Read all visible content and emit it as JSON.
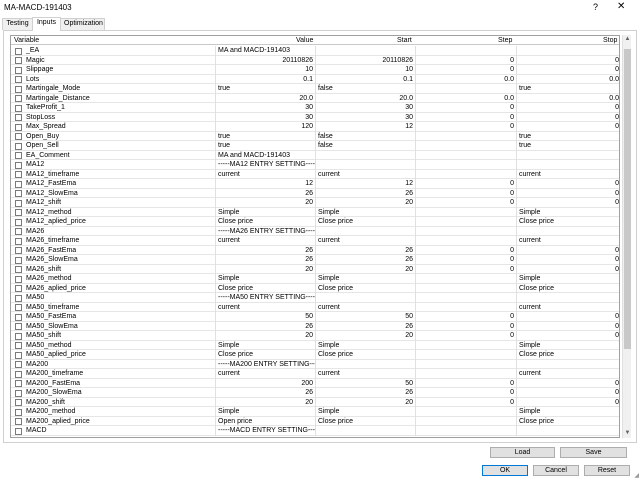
{
  "window": {
    "title": "MA-MACD-191403"
  },
  "tabs": [
    {
      "label": "Testing"
    },
    {
      "label": "Inputs"
    },
    {
      "label": "Optimization"
    }
  ],
  "columns": {
    "variable": "Variable",
    "value": "Value",
    "start": "Start",
    "step": "Step",
    "stop": "Stop"
  },
  "rows": [
    {
      "name": "_EA",
      "value": "MA and MACD-191403",
      "start": "",
      "step": "",
      "stop": ""
    },
    {
      "name": "Magic",
      "value": "20110826",
      "start": "20110826",
      "step": "0",
      "stop": "0",
      "num": true
    },
    {
      "name": "Slippage",
      "value": "10",
      "start": "10",
      "step": "0",
      "stop": "0",
      "num": true
    },
    {
      "name": "Lots",
      "value": "0.1",
      "start": "0.1",
      "step": "0.0",
      "stop": "0.0",
      "num": true
    },
    {
      "name": "Martingale_Mode",
      "value": "true",
      "start": "false",
      "step": "",
      "stop": "true"
    },
    {
      "name": "Martingale_Distance",
      "value": "20.0",
      "start": "20.0",
      "step": "0.0",
      "stop": "0.0",
      "num": true
    },
    {
      "name": "TakeProfit_1",
      "value": "30",
      "start": "30",
      "step": "0",
      "stop": "0",
      "num": true
    },
    {
      "name": "StopLoss",
      "value": "30",
      "start": "30",
      "step": "0",
      "stop": "0",
      "num": true
    },
    {
      "name": "Max_Spread",
      "value": "120",
      "start": "12",
      "step": "0",
      "stop": "0",
      "num": true
    },
    {
      "name": "Open_Buy",
      "value": "true",
      "start": "false",
      "step": "",
      "stop": "true"
    },
    {
      "name": "Open_Sell",
      "value": "true",
      "start": "false",
      "step": "",
      "stop": "true"
    },
    {
      "name": "EA_Comment",
      "value": "MA and MACD-191403",
      "start": "",
      "step": "",
      "stop": ""
    },
    {
      "name": "MA12",
      "value": "-----MA12 ENTRY SETTING-----",
      "start": "",
      "step": "",
      "stop": ""
    },
    {
      "name": "MA12_timeframe",
      "value": "current",
      "start": "current",
      "step": "",
      "stop": "current"
    },
    {
      "name": "MA12_FastEma",
      "value": "12",
      "start": "12",
      "step": "0",
      "stop": "0",
      "num": true
    },
    {
      "name": "MA12_SlowEma",
      "value": "26",
      "start": "26",
      "step": "0",
      "stop": "0",
      "num": true
    },
    {
      "name": "MA12_shift",
      "value": "20",
      "start": "20",
      "step": "0",
      "stop": "0",
      "num": true
    },
    {
      "name": "MA12_method",
      "value": "Simple",
      "start": "Simple",
      "step": "",
      "stop": "Simple"
    },
    {
      "name": "MA12_aplied_price",
      "value": "Close price",
      "start": "Close price",
      "step": "",
      "stop": "Close price"
    },
    {
      "name": "MA26",
      "value": "-----MA26 ENTRY SETTING-----",
      "start": "",
      "step": "",
      "stop": ""
    },
    {
      "name": "MA26_timeframe",
      "value": "current",
      "start": "current",
      "step": "",
      "stop": "current"
    },
    {
      "name": "MA26_FastEma",
      "value": "26",
      "start": "26",
      "step": "0",
      "stop": "0",
      "num": true
    },
    {
      "name": "MA26_SlowEma",
      "value": "26",
      "start": "26",
      "step": "0",
      "stop": "0",
      "num": true
    },
    {
      "name": "MA26_shift",
      "value": "20",
      "start": "20",
      "step": "0",
      "stop": "0",
      "num": true
    },
    {
      "name": "MA26_method",
      "value": "Simple",
      "start": "Simple",
      "step": "",
      "stop": "Simple"
    },
    {
      "name": "MA26_aplied_price",
      "value": "Close price",
      "start": "Close price",
      "step": "",
      "stop": "Close price"
    },
    {
      "name": "MA50",
      "value": "-----MA50 ENTRY SETTING-----",
      "start": "",
      "step": "",
      "stop": ""
    },
    {
      "name": "MA50_timeframe",
      "value": "current",
      "start": "current",
      "step": "",
      "stop": "current"
    },
    {
      "name": "MA50_FastEma",
      "value": "50",
      "start": "50",
      "step": "0",
      "stop": "0",
      "num": true
    },
    {
      "name": "MA50_SlowEma",
      "value": "26",
      "start": "26",
      "step": "0",
      "stop": "0",
      "num": true
    },
    {
      "name": "MA50_shift",
      "value": "20",
      "start": "20",
      "step": "0",
      "stop": "0",
      "num": true
    },
    {
      "name": "MA50_method",
      "value": "Simple",
      "start": "Simple",
      "step": "",
      "stop": "Simple"
    },
    {
      "name": "MA50_aplied_price",
      "value": "Close price",
      "start": "Close price",
      "step": "",
      "stop": "Close price"
    },
    {
      "name": "MA200",
      "value": "-----MA200 ENTRY SETTING-----",
      "start": "",
      "step": "",
      "stop": ""
    },
    {
      "name": "MA200_timeframe",
      "value": "current",
      "start": "current",
      "step": "",
      "stop": "current"
    },
    {
      "name": "MA200_FastEma",
      "value": "200",
      "start": "50",
      "step": "0",
      "stop": "0",
      "num": true
    },
    {
      "name": "MA200_SlowEma",
      "value": "26",
      "start": "26",
      "step": "0",
      "stop": "0",
      "num": true
    },
    {
      "name": "MA200_shift",
      "value": "20",
      "start": "20",
      "step": "0",
      "stop": "0",
      "num": true
    },
    {
      "name": "MA200_method",
      "value": "Simple",
      "start": "Simple",
      "step": "",
      "stop": "Simple"
    },
    {
      "name": "MA200_aplied_price",
      "value": "Open price",
      "start": "Close price",
      "step": "",
      "stop": "Close price"
    },
    {
      "name": "MACD",
      "value": "-----MACD ENTRY SETTING-----",
      "start": "",
      "step": "",
      "stop": ""
    }
  ],
  "buttons": {
    "load": "Load",
    "save": "Save",
    "ok": "OK",
    "cancel": "Cancel",
    "reset": "Reset"
  },
  "icons": {
    "help": "?",
    "close": "✕",
    "scroll_up": "▲",
    "scroll_down": "▼"
  }
}
